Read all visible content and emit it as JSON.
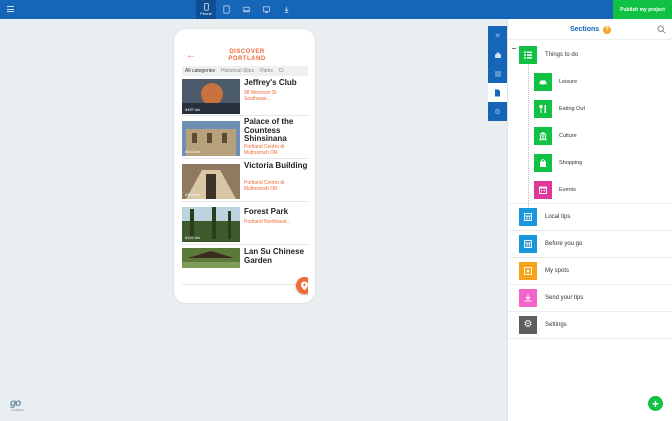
{
  "topbar": {
    "devices": [
      {
        "name": "phone",
        "label": "Phone",
        "active": true
      },
      {
        "name": "tablet",
        "label": "",
        "active": false
      },
      {
        "name": "laptop",
        "label": "",
        "active": false
      },
      {
        "name": "desktop",
        "label": "",
        "active": false
      },
      {
        "name": "download",
        "label": "",
        "active": false
      }
    ],
    "publish_label": "Publish my project"
  },
  "phone": {
    "logo_line1": "DISCOVER",
    "logo_line2": "PORTLAND",
    "tabs": [
      "All categories",
      "Historical Sites",
      "Parks",
      "Ci"
    ],
    "items": [
      {
        "title": "Jeffrey's Club",
        "address": "98 Morrison St Southeast...",
        "distance": "5497 km"
      },
      {
        "title": "Palace of the Countess Shinsinana",
        "address": "Portland Centro di Multnomah OR",
        "distance": "6004 km"
      },
      {
        "title": "Victoria Building",
        "address": "Portland Centro di Multnomah OR",
        "distance": "6104 km"
      },
      {
        "title": "Forest Park",
        "address": "Portland Northwest...",
        "distance": "6165 km"
      },
      {
        "title": "Lan Su Chinese Garden",
        "address": "",
        "distance": ""
      }
    ]
  },
  "panel": {
    "title": "Sections",
    "help": "?",
    "sections": [
      {
        "label": "Things to do",
        "color": "#11c143",
        "icon": "list-icon"
      },
      {
        "label": "Leisure",
        "color": "#11c143",
        "icon": "car-icon"
      },
      {
        "label": "Eating Out",
        "color": "#11c143",
        "icon": "cutlery-icon"
      },
      {
        "label": "Culture",
        "color": "#11c143",
        "icon": "museum-icon"
      },
      {
        "label": "Shopping",
        "color": "#11c143",
        "icon": "shopping-bag-icon"
      },
      {
        "label": "Events",
        "color": "#e0379a",
        "icon": "calendar-icon"
      },
      {
        "label": "Local tips",
        "color": "#1a96dc",
        "icon": "grid-icon"
      },
      {
        "label": "Before you go",
        "color": "#1a96dc",
        "icon": "grid-icon"
      },
      {
        "label": "My spots",
        "color": "#f6a41b",
        "icon": "favorites-icon"
      },
      {
        "label": "Send your tips",
        "color": "#f264c9",
        "icon": "upload-icon"
      },
      {
        "label": "Settings",
        "color": "#5e5e5e",
        "icon": "gear-icon"
      }
    ]
  },
  "brand": {
    "logo": "go",
    "tagline": "GoodBarber"
  }
}
